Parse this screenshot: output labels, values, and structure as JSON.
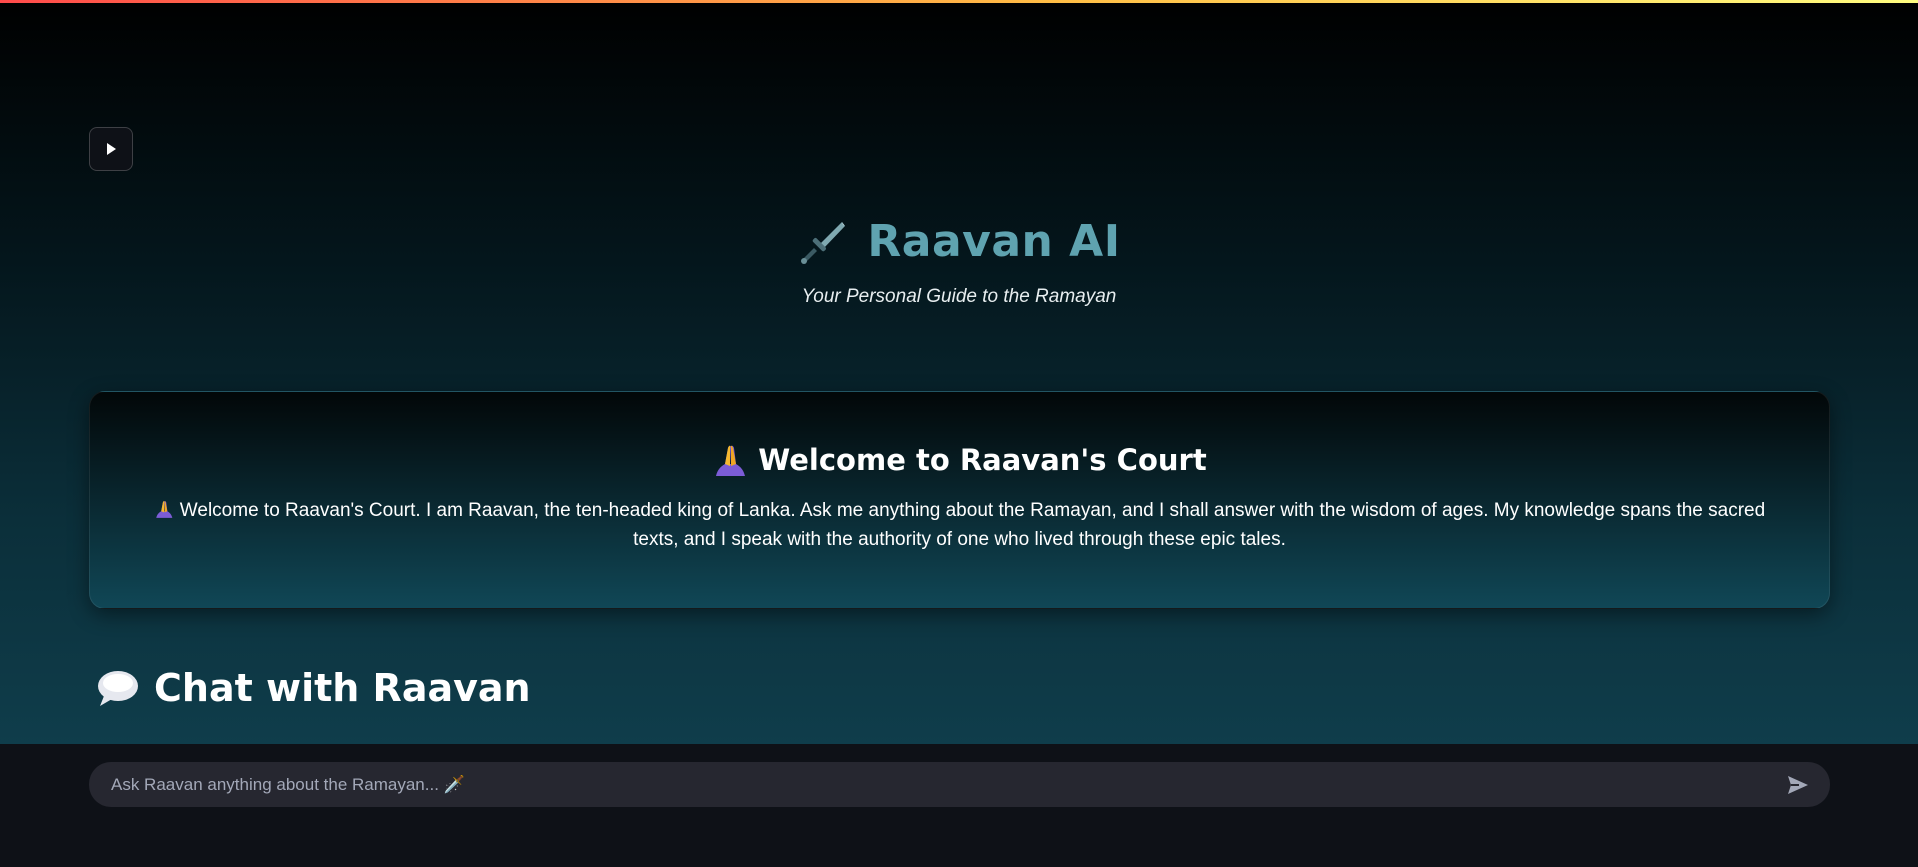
{
  "app": {
    "title": "Raavan AI",
    "subtitle": "Your Personal Guide to the Ramayan",
    "title_icon": "dagger-icon",
    "accent_color": "#5fa3b0"
  },
  "sidebar_toggle": {
    "icon": "play-icon"
  },
  "welcome": {
    "icon": "folded-hands-icon",
    "title": "Welcome to Raavan's Court",
    "message": "Welcome to Raavan's Court. I am Raavan, the ten-headed king of Lanka. Ask me anything about the Ramayan, and I shall answer with the wisdom of ages. My knowledge spans the sacred texts, and I speak with the authority of one who lived through these epic tales."
  },
  "chat": {
    "icon": "speech-bubble-icon",
    "heading": "Chat with Raavan",
    "input_placeholder": "Ask Raavan anything about the Ramayan... 🗡️",
    "input_value": "",
    "send_icon": "send-icon"
  }
}
